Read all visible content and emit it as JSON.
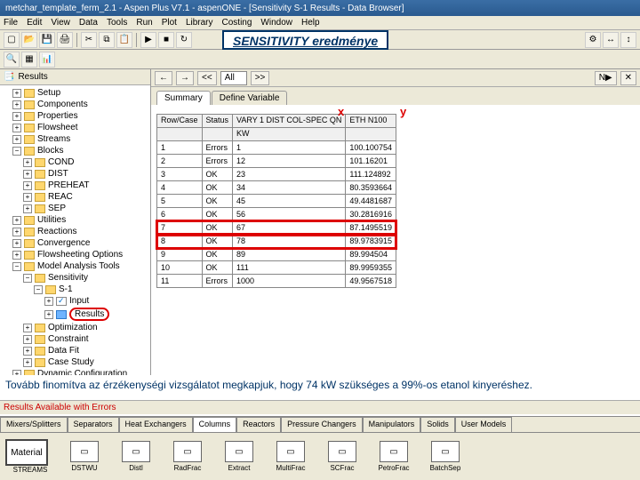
{
  "window": {
    "title": "metchar_template_ferm_2.1 - Aspen Plus V7.1 - aspenONE - [Sensitivity S-1 Results - Data Browser]"
  },
  "menu": {
    "items": [
      "File",
      "Edit",
      "View",
      "Data",
      "Tools",
      "Run",
      "Plot",
      "Library",
      "Costing",
      "Window",
      "Help"
    ]
  },
  "banner": {
    "text": "SENSITIVITY eredménye"
  },
  "left": {
    "header": "Results"
  },
  "tree": {
    "items": [
      {
        "label": "Setup",
        "d": 1
      },
      {
        "label": "Components",
        "d": 1
      },
      {
        "label": "Properties",
        "d": 1
      },
      {
        "label": "Flowsheet",
        "d": 1
      },
      {
        "label": "Streams",
        "d": 1
      },
      {
        "label": "Blocks",
        "d": 1,
        "exp": true
      },
      {
        "label": "COND",
        "d": 2
      },
      {
        "label": "DIST",
        "d": 2
      },
      {
        "label": "PREHEAT",
        "d": 2
      },
      {
        "label": "REAC",
        "d": 2
      },
      {
        "label": "SEP",
        "d": 2
      },
      {
        "label": "Utilities",
        "d": 1
      },
      {
        "label": "Reactions",
        "d": 1
      },
      {
        "label": "Convergence",
        "d": 1
      },
      {
        "label": "Flowsheeting Options",
        "d": 1
      },
      {
        "label": "Model Analysis Tools",
        "d": 1,
        "exp": true
      },
      {
        "label": "Sensitivity",
        "d": 2,
        "exp": true
      },
      {
        "label": "S-1",
        "d": 3,
        "exp": true
      },
      {
        "label": "Input",
        "d": 4,
        "check": true
      },
      {
        "label": "Results",
        "d": 4,
        "blue": true,
        "circled": true
      },
      {
        "label": "Optimization",
        "d": 2
      },
      {
        "label": "Constraint",
        "d": 2
      },
      {
        "label": "Data Fit",
        "d": 2
      },
      {
        "label": "Case Study",
        "d": 2
      },
      {
        "label": "Dynamic Configuration",
        "d": 1
      }
    ]
  },
  "nav": {
    "back": "←",
    "fwd": "→",
    "prev": "<<",
    "sel": "All",
    "next": ">>"
  },
  "tabs": {
    "a": "Summary",
    "b": "Define Variable"
  },
  "chart_data": {
    "type": "table",
    "title": "Sensitivity S-1 Results",
    "columns": [
      "Row/Case",
      "Status",
      "VARY 1 DIST COL-SPEC QN",
      "ETH N100"
    ],
    "unit_row": [
      "",
      "",
      "KW",
      ""
    ],
    "xcol": 2,
    "ycol": 3,
    "rows": [
      [
        "1",
        "Errors",
        "1",
        "100.100754"
      ],
      [
        "2",
        "Errors",
        "12",
        "101.16201"
      ],
      [
        "3",
        "OK",
        "23",
        "111.124892"
      ],
      [
        "4",
        "OK",
        "34",
        "80.3593664"
      ],
      [
        "5",
        "OK",
        "45",
        "49.4481687"
      ],
      [
        "6",
        "OK",
        "56",
        "30.2816916"
      ],
      [
        "7",
        "OK",
        "67",
        "87.1495519"
      ],
      [
        "8",
        "OK",
        "78",
        "89.9783915"
      ],
      [
        "9",
        "OK",
        "89",
        "89.994504"
      ],
      [
        "10",
        "OK",
        "111",
        "89.9959355"
      ],
      [
        "11",
        "Errors",
        "1000",
        "49.9567518"
      ]
    ],
    "highlight_rows": [
      6,
      7
    ],
    "xlabel": "x",
    "ylabel": "y"
  },
  "note": {
    "text": "Tovább finomítva az érzékenységi vizsgálatot megkapjuk, hogy 74 kW szükséges a 99%-os etanol kinyeréshez."
  },
  "status": {
    "text": "Results Available with Errors"
  },
  "palette": {
    "tabs": [
      "Mixers/Splitters",
      "Separators",
      "Heat Exchangers",
      "Columns",
      "Reactors",
      "Pressure Changers",
      "Manipulators",
      "Solids",
      "User Models"
    ],
    "active": 3,
    "material": "Material",
    "streams_lbl": "STREAMS",
    "items": [
      {
        "label": "DSTWU"
      },
      {
        "label": "Distl"
      },
      {
        "label": "RadFrac"
      },
      {
        "label": "Extract"
      },
      {
        "label": "MultiFrac"
      },
      {
        "label": "SCFrac"
      },
      {
        "label": "PetroFrac"
      },
      {
        "label": "BatchSep"
      }
    ]
  }
}
